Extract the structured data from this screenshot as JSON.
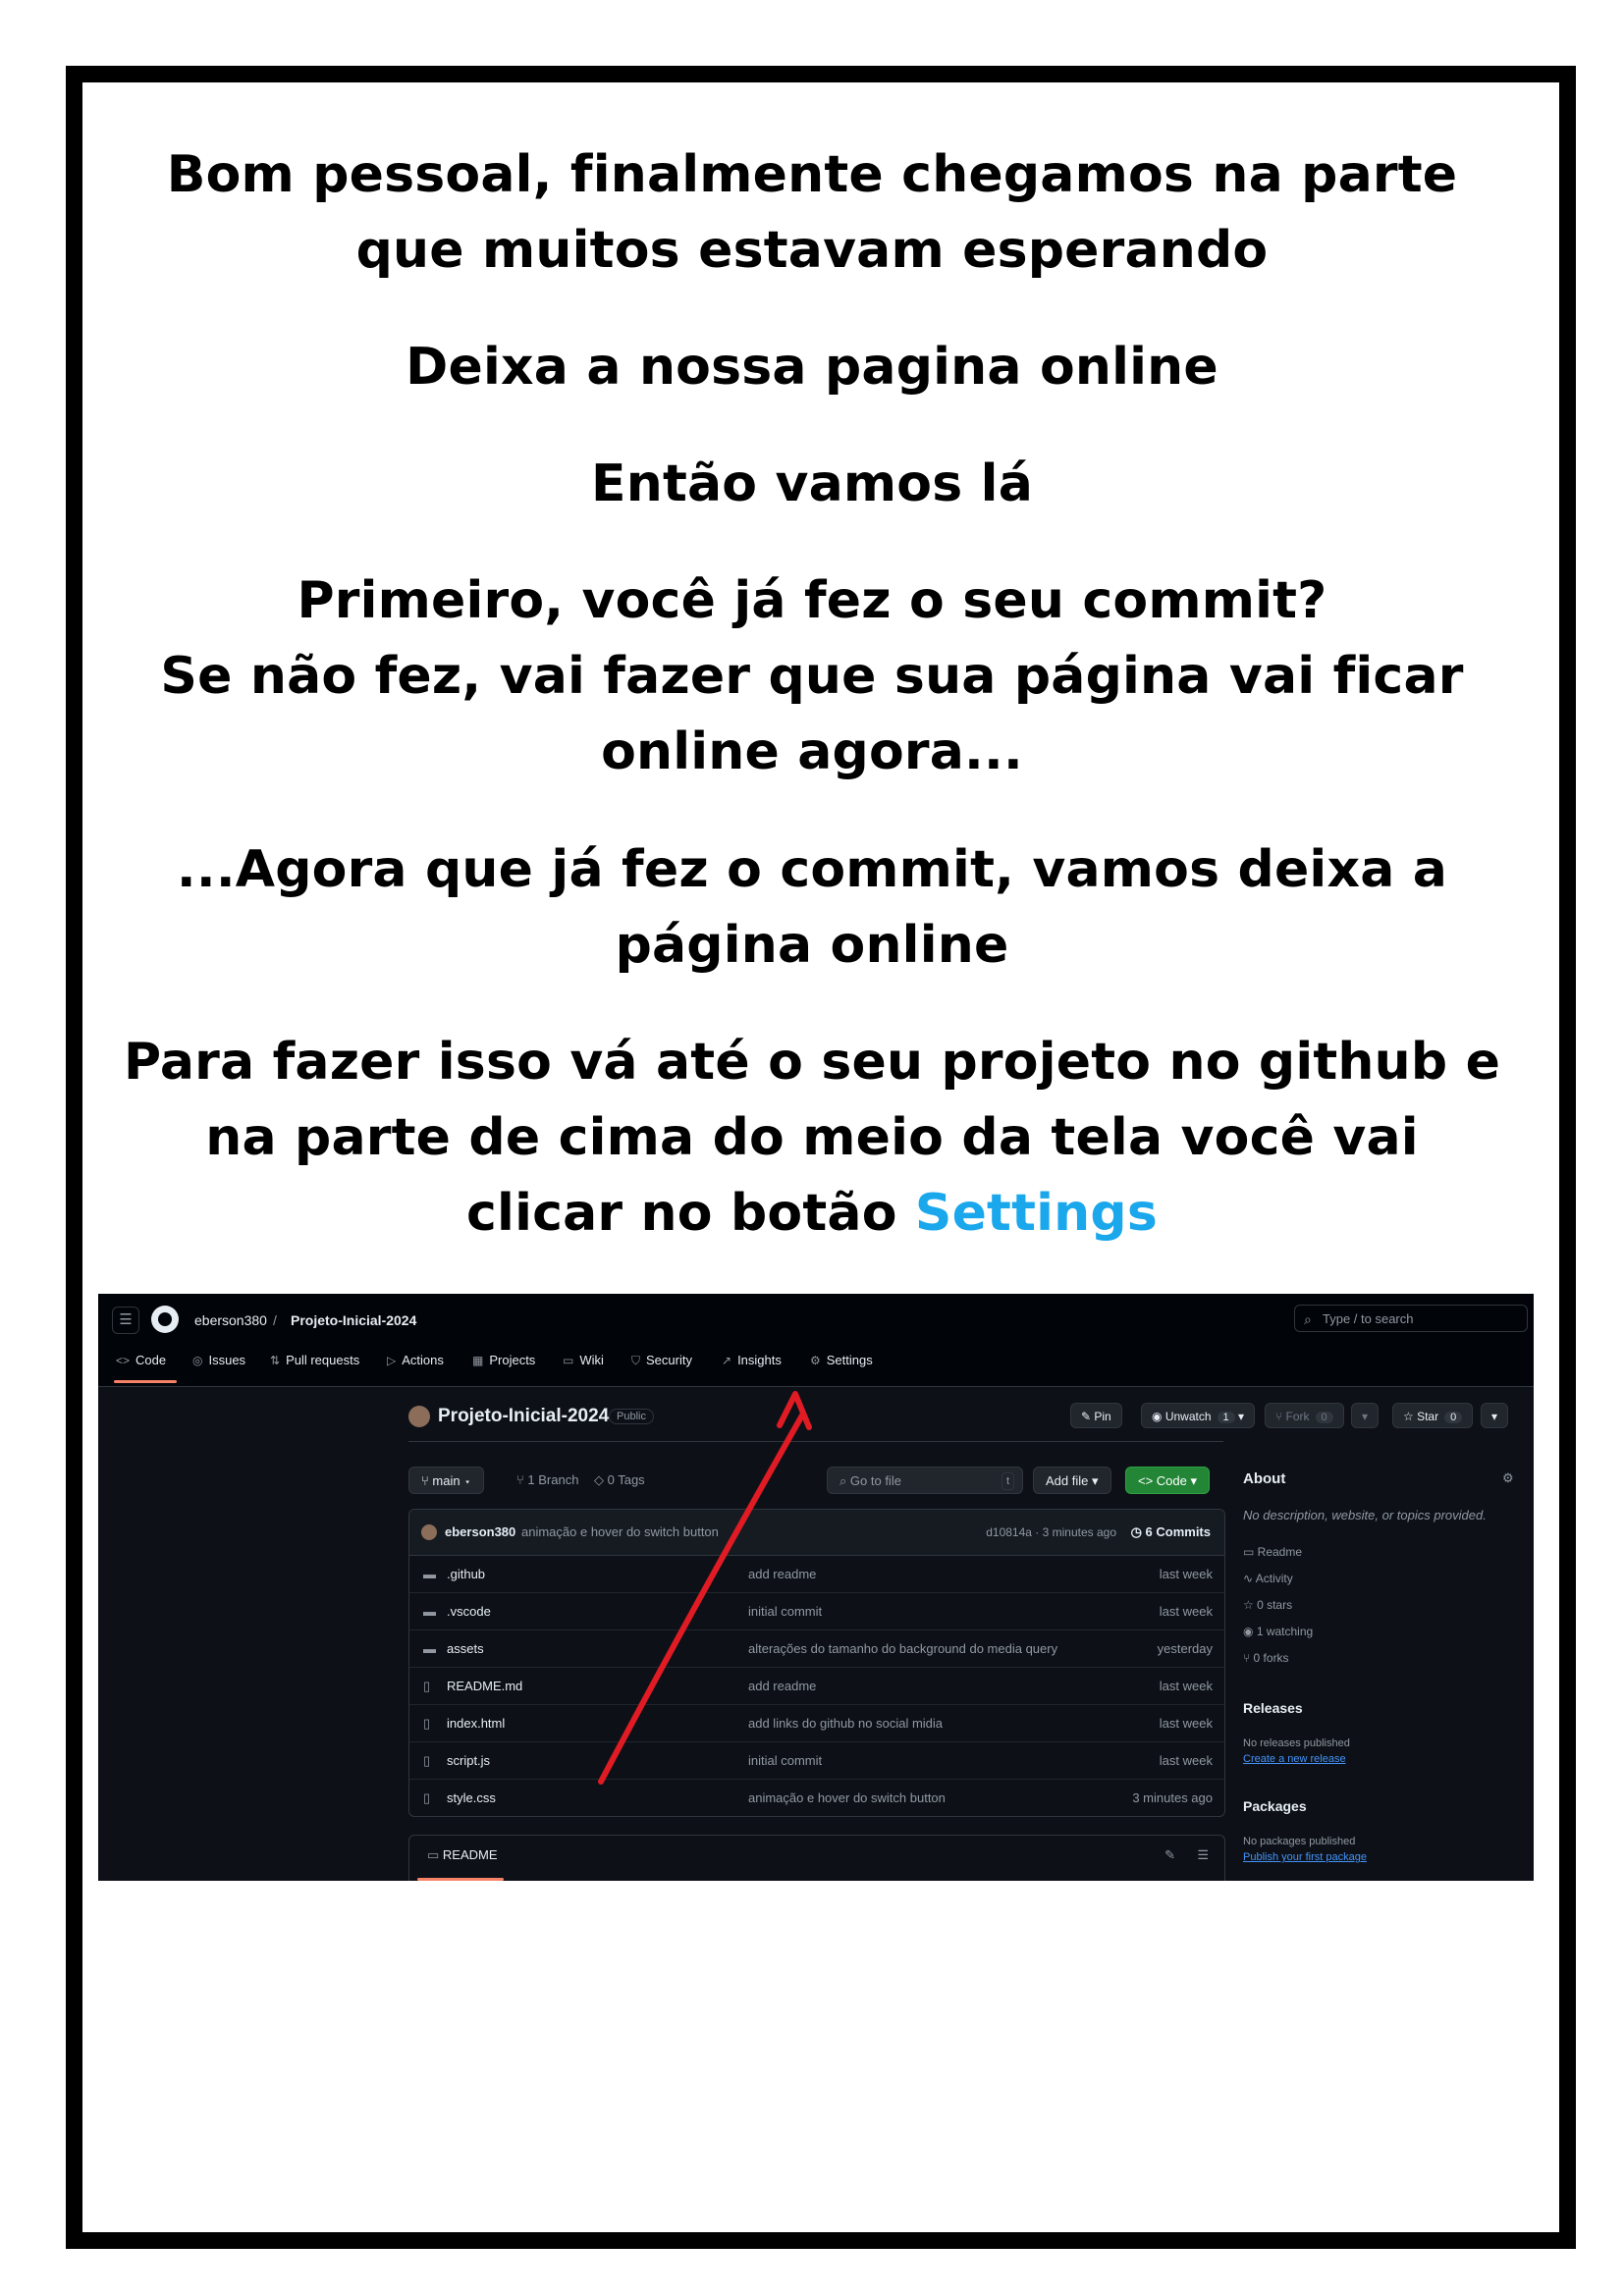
{
  "instructions": {
    "line1": "Bom pessoal, finalmente chegamos na parte",
    "line2": "que muitos estavam esperando",
    "line3": "Deixa a nossa pagina online",
    "line4": "Então vamos lá",
    "line5": "Primeiro, você já fez o seu commit?",
    "line6": "Se não fez, vai fazer que sua página vai ficar",
    "line7": "online agora...",
    "line8": "...Agora que já fez o commit, vamos deixa a",
    "line9": "página online",
    "line10": "Para fazer isso vá até o seu projeto no github e",
    "line11": "na parte de cima do meio da tela você vai",
    "line12_prefix": "clicar no botão ",
    "line12_highlight": "Settings",
    "highlight_color": "#1aa7ec"
  },
  "github": {
    "owner": "eberson380",
    "separator": "/",
    "repo": "Projeto-Inicial-2024",
    "search_placeholder": "Type / to search",
    "tabs": [
      {
        "label": "Code",
        "icon": "code-icon"
      },
      {
        "label": "Issues",
        "icon": "issue-icon"
      },
      {
        "label": "Pull requests",
        "icon": "pull-request-icon"
      },
      {
        "label": "Actions",
        "icon": "play-icon"
      },
      {
        "label": "Projects",
        "icon": "table-icon"
      },
      {
        "label": "Wiki",
        "icon": "book-icon"
      },
      {
        "label": "Security",
        "icon": "shield-icon"
      },
      {
        "label": "Insights",
        "icon": "graph-icon"
      },
      {
        "label": "Settings",
        "icon": "gear-icon"
      }
    ],
    "repo_title": "Projeto-Inicial-2024",
    "visibility": "Public",
    "pin": "Pin",
    "unwatch": "Unwatch",
    "unwatch_count": "1",
    "fork": "Fork",
    "fork_count": "0",
    "star": "Star",
    "star_count": "0",
    "branch": "main",
    "branches": "1 Branch",
    "tags": "0 Tags",
    "go_to_file": "Go to file",
    "go_to_file_key": "t",
    "add_file": "Add file",
    "code_button": "Code",
    "commit_author": "eberson380",
    "commit_message": "animação e hover do switch button",
    "commit_hash_time": "d10814a · 3 minutes ago",
    "commits": "6 Commits",
    "files": [
      {
        "name": ".github",
        "type": "folder",
        "message": "add readme",
        "time": "last week"
      },
      {
        "name": ".vscode",
        "type": "folder",
        "message": "initial commit",
        "time": "last week"
      },
      {
        "name": "assets",
        "type": "folder",
        "message": "alterações do tamanho do background do media query",
        "time": "yesterday"
      },
      {
        "name": "README.md",
        "type": "file",
        "message": "add readme",
        "time": "last week"
      },
      {
        "name": "index.html",
        "type": "file",
        "message": "add links do github no social midia",
        "time": "last week"
      },
      {
        "name": "script.js",
        "type": "file",
        "message": "initial commit",
        "time": "last week"
      },
      {
        "name": "style.css",
        "type": "file",
        "message": "animação e hover do switch button",
        "time": "3 minutes ago"
      }
    ],
    "readme_tab": "README",
    "about": {
      "title": "About",
      "description": "No description, website, or topics provided.",
      "items": [
        "Readme",
        "Activity",
        "0 stars",
        "1 watching",
        "0 forks"
      ],
      "releases_title": "Releases",
      "releases_text": "No releases published",
      "releases_link": "Create a new release",
      "packages_title": "Packages",
      "packages_text": "No packages published",
      "packages_link": "Publish your first package"
    },
    "arrow_color": "#e01b24"
  }
}
